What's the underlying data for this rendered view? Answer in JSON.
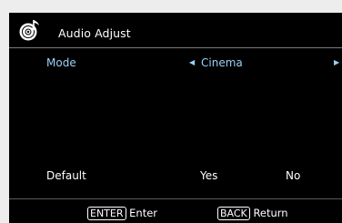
{
  "header": {
    "title": "Audio Adjust",
    "icon": "disc-music-icon"
  },
  "settings": {
    "mode": {
      "label": "Mode",
      "value": "Cinema"
    },
    "default": {
      "label": "Default",
      "options": [
        "Yes",
        "No"
      ]
    }
  },
  "footer": {
    "enter_key": "ENTER",
    "enter_text": "Enter",
    "back_key": "BACK",
    "back_text": "Return"
  },
  "colors": {
    "background": "#000000",
    "highlight": "#9bd0f5",
    "frame": "#ededed"
  }
}
